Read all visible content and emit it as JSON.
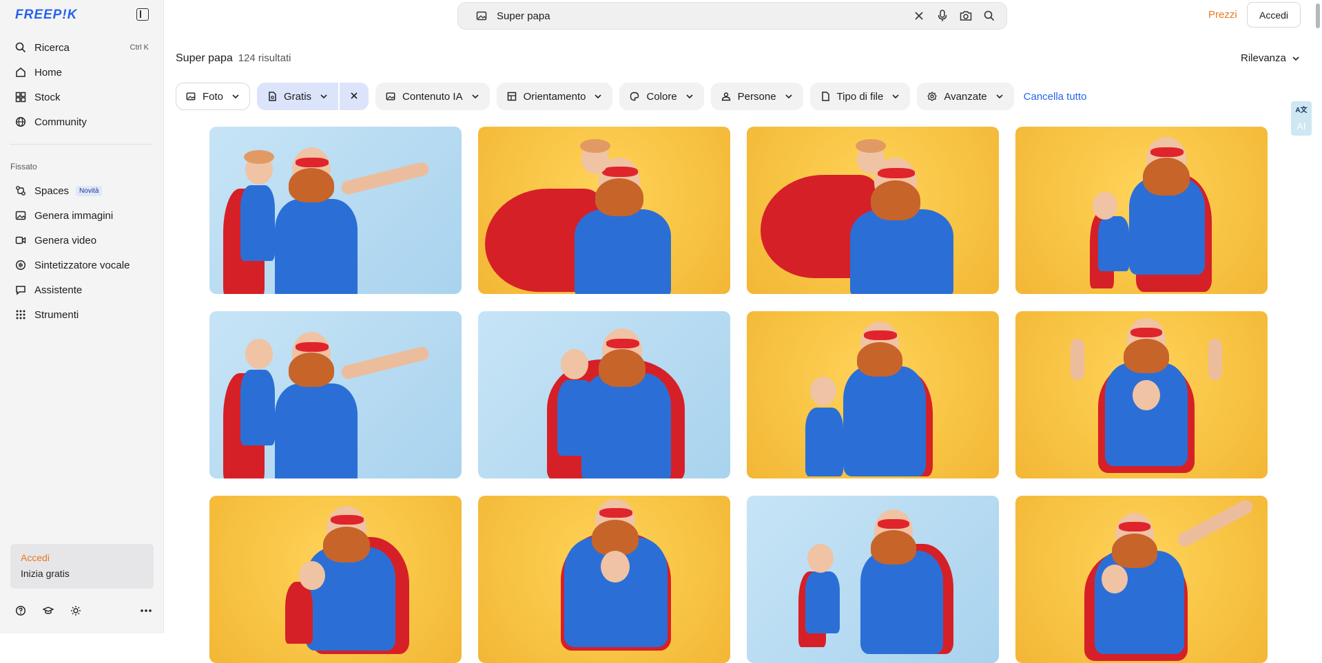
{
  "sidebar": {
    "logo": "FREEP!K",
    "nav": [
      {
        "label": "Ricerca",
        "shortcut": "Ctrl K",
        "icon": "search-icon"
      },
      {
        "label": "Home",
        "icon": "home-icon"
      },
      {
        "label": "Stock",
        "icon": "stock-icon"
      },
      {
        "label": "Community",
        "icon": "globe-icon"
      }
    ],
    "pinned_label": "Fissato",
    "pinned": [
      {
        "label": "Spaces",
        "badge": "Novità",
        "icon": "spaces-icon"
      },
      {
        "label": "Genera immagini",
        "icon": "image-icon"
      },
      {
        "label": "Genera video",
        "icon": "video-icon"
      },
      {
        "label": "Sintetizzatore vocale",
        "icon": "voice-icon"
      },
      {
        "label": "Assistente",
        "icon": "chat-icon"
      },
      {
        "label": "Strumenti",
        "icon": "grid-icon"
      }
    ],
    "login": {
      "accedi": "Accedi",
      "inizia": "Inizia gratis"
    },
    "bottom_icons": [
      "help-icon",
      "academy-icon",
      "theme-icon",
      "more-icon"
    ]
  },
  "topbar": {
    "search_query": "Super papa",
    "prezzi": "Prezzi",
    "accedi": "Accedi"
  },
  "results": {
    "title": "Super papa",
    "count": "124 risultati",
    "sort": "Rilevanza"
  },
  "filters": {
    "foto": "Foto",
    "gratis": "Gratis",
    "contenuto_ia": "Contenuto IA",
    "orientamento": "Orientamento",
    "colore": "Colore",
    "persone": "Persone",
    "tipo_file": "Tipo di file",
    "avanzate": "Avanzate",
    "cancella": "Cancella tutto"
  },
  "ai_float": {
    "label": "AI"
  },
  "colors": {
    "accent_blue": "#2563eb",
    "accent_orange": "#e8771e",
    "bg_blue": "#a9d3ee",
    "bg_yellow": "#f8c444"
  }
}
